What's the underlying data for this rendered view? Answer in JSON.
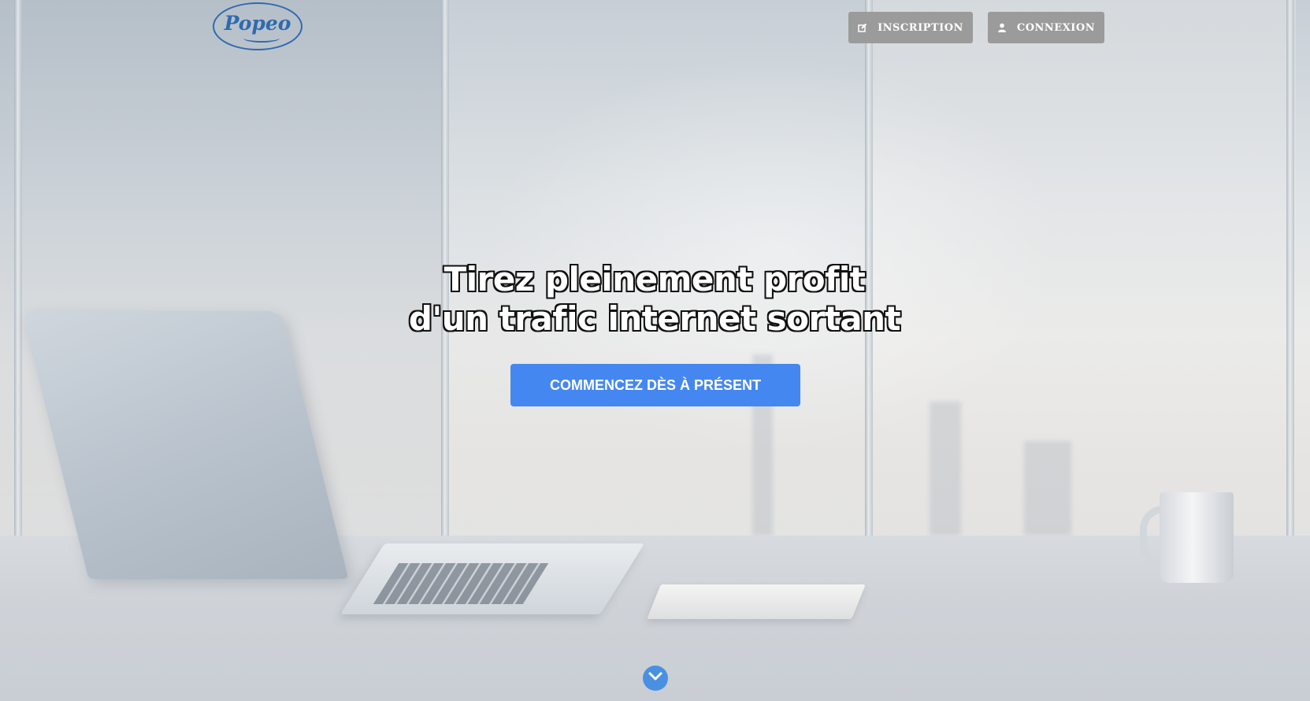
{
  "header": {
    "logo_text": "Popeo",
    "buttons": {
      "inscription": {
        "label": "INSCRIPTION",
        "icon": "edit-icon"
      },
      "connexion": {
        "label": "CONNEXION",
        "icon": "user-icon"
      }
    }
  },
  "hero": {
    "headline_line1": "Tirez pleinement profit",
    "headline_line2": "d'un trafic internet sortant",
    "cta_label": "COMMENCEZ DÈS À PRÉSENT",
    "scroll_icon": "chevron-down-icon"
  },
  "colors": {
    "brand": "#2f6ab0",
    "cta": "#4587f0",
    "nav_button": "#9b9b9b",
    "scroll_button": "#4a90e2"
  }
}
